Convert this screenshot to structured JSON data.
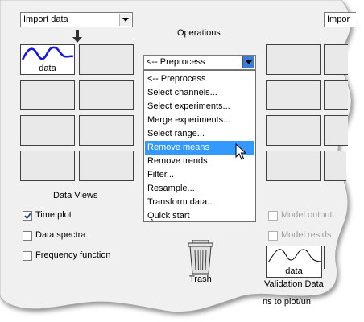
{
  "left_combo": {
    "value": "Import data"
  },
  "right_combo": {
    "value": "Impor"
  },
  "operations": {
    "label": "Operations",
    "combo_value": "<-- Preprocess",
    "menu_items": [
      {
        "label": "<-- Preprocess",
        "selected": false
      },
      {
        "label": "Select channels...",
        "selected": false
      },
      {
        "label": "Select experiments...",
        "selected": false
      },
      {
        "label": "Merge experiments...",
        "selected": false
      },
      {
        "label": "Select range...",
        "selected": false
      },
      {
        "label": "Remove means",
        "selected": true
      },
      {
        "label": "Remove trends",
        "selected": false
      },
      {
        "label": "Filter...",
        "selected": false
      },
      {
        "label": "Resample...",
        "selected": false
      },
      {
        "label": "Transform data...",
        "selected": false
      },
      {
        "label": "Quick start",
        "selected": false
      }
    ]
  },
  "data_views": {
    "title": "Data Views",
    "data_tile_label": "data",
    "checkboxes": [
      {
        "label": "Time plot",
        "checked": true
      },
      {
        "label": "Data spectra",
        "checked": false
      },
      {
        "label": "Frequency function",
        "checked": false
      }
    ]
  },
  "model_views": {
    "checkboxes": [
      {
        "label": "Model output",
        "checked": false,
        "enabled": false
      },
      {
        "label": "Model resids",
        "checked": false,
        "enabled": false
      }
    ]
  },
  "trash": {
    "label": "Trash"
  },
  "validation": {
    "tile_label": "data",
    "caption": "Validation Data"
  },
  "footer_fragment": "ns to plot/un",
  "colors": {
    "menu_highlight": "#3399ff",
    "plot_line": "#1a1ad6",
    "tile_fill": "#e9e9e9"
  },
  "icons": [
    "dropdown-arrow-icon",
    "down-arrow-icon",
    "mouse-cursor-icon",
    "trash-can-icon",
    "checkmark-icon"
  ]
}
